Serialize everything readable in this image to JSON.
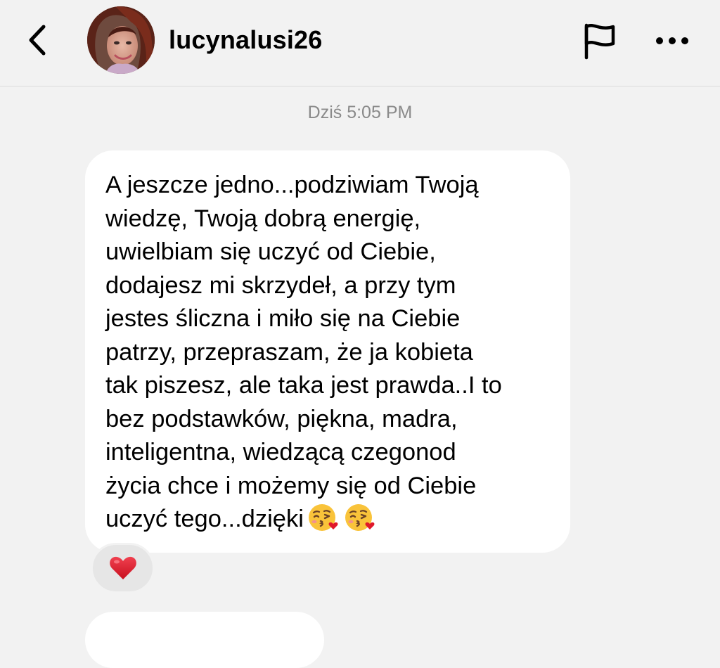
{
  "header": {
    "username": "lucynalusi26",
    "back_icon": "chevron-left-icon",
    "flag_icon": "flag-icon",
    "more_icon": "more-horizontal-icon"
  },
  "conversation": {
    "timestamp": "Dziś 5:05 PM",
    "message": {
      "lines": [
        "A jeszcze jedno...podziwiam Twoją",
        "wiedzę, Twoją dobrą energię,",
        "uwielbiam się uczyć od Ciebie,",
        "dodajesz mi skrzydeł, a przy tym",
        "jestes śliczna i miło się na Ciebie",
        "patrzy, przepraszam, że ja kobieta",
        "tak piszesz, ale taka jest prawda..I to",
        "bez podstawków, piękna, madra,",
        "inteligentna, wiedzącą czegonod",
        "życia chce i możemy się od Ciebie",
        "uczyć tego...dzięki"
      ],
      "trailing_emoji": [
        "face-blowing-a-kiss",
        "face-blowing-a-kiss"
      ]
    },
    "reaction": "red-heart"
  },
  "colors": {
    "background": "#f2f2f2",
    "bubble": "#ffffff",
    "timestamp": "#8a8a8a",
    "reaction_pill": "#e6e6e6",
    "heart": "#e0182b"
  }
}
